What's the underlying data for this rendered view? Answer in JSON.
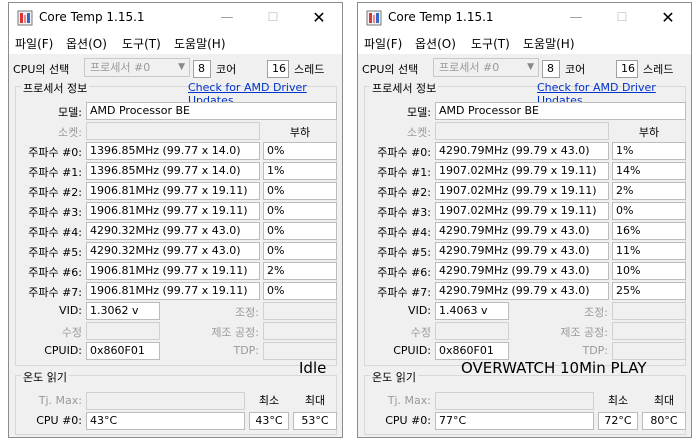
{
  "windows": [
    {
      "title": "Core Temp 1.15.1",
      "menu": [
        "파일(F)",
        "옵션(O)",
        "도구(T)",
        "도움말(H)"
      ],
      "cpu_select_label": "CPU의 선택",
      "processor_combo": "프로세서 #0",
      "cores_value": "8",
      "cores_label": "코어",
      "threads_value": "16",
      "threads_label": "스레드",
      "proc_info_label": "프로세서 정보",
      "driver_link": "Check for AMD Driver Updates",
      "model_label": "모델:",
      "model_value": "AMD Processor  BE",
      "socket_label": "소켓:",
      "load_header": "부하",
      "freqs": [
        {
          "label": "주파수 #0:",
          "value": "1396.85MHz (99.77 x 14.0)",
          "load": "0%"
        },
        {
          "label": "주파수 #1:",
          "value": "1396.85MHz (99.77 x 14.0)",
          "load": "1%"
        },
        {
          "label": "주파수 #2:",
          "value": "1906.81MHz (99.77 x 19.11)",
          "load": "0%"
        },
        {
          "label": "주파수 #3:",
          "value": "1906.81MHz (99.77 x 19.11)",
          "load": "0%"
        },
        {
          "label": "주파수 #4:",
          "value": "4290.32MHz (99.77 x 43.0)",
          "load": "0%"
        },
        {
          "label": "주파수 #5:",
          "value": "4290.32MHz (99.77 x 43.0)",
          "load": "0%"
        },
        {
          "label": "주파수 #6:",
          "value": "1906.81MHz (99.77 x 19.11)",
          "load": "2%"
        },
        {
          "label": "주파수 #7:",
          "value": "1906.81MHz (99.77 x 19.11)",
          "load": "0%"
        }
      ],
      "vid_label": "VID:",
      "vid_value": "1.3062 v",
      "revision_label": "수정",
      "lithography_label": "조정:",
      "production_label": "제조 공정:",
      "cpuid_label": "CPUID:",
      "cpuid_value": "0x860F01",
      "tdp_label": "TDP:",
      "temp_group_label": "온도 읽기",
      "tjmax_label": "Tj. Max:",
      "min_label": "최소",
      "max_label": "최대",
      "cpu0_label": "CPU #0:",
      "cpu0_temp": "43°C",
      "cpu0_min": "43°C",
      "cpu0_max": "53°C"
    },
    {
      "title": "Core Temp 1.15.1",
      "menu": [
        "파일(F)",
        "옵션(O)",
        "도구(T)",
        "도움말(H)"
      ],
      "cpu_select_label": "CPU의 선택",
      "processor_combo": "프로세서 #0",
      "cores_value": "8",
      "cores_label": "코어",
      "threads_value": "16",
      "threads_label": "스레드",
      "proc_info_label": "프로세서 정보",
      "driver_link": "Check for AMD Driver Updates",
      "model_label": "모델:",
      "model_value": "AMD Processor  BE",
      "socket_label": "소켓:",
      "load_header": "부하",
      "freqs": [
        {
          "label": "주파수 #0:",
          "value": "4290.79MHz (99.79 x 43.0)",
          "load": "1%"
        },
        {
          "label": "주파수 #1:",
          "value": "1907.02MHz (99.79 x 19.11)",
          "load": "14%"
        },
        {
          "label": "주파수 #2:",
          "value": "1907.02MHz (99.79 x 19.11)",
          "load": "2%"
        },
        {
          "label": "주파수 #3:",
          "value": "1907.02MHz (99.79 x 19.11)",
          "load": "0%"
        },
        {
          "label": "주파수 #4:",
          "value": "4290.79MHz (99.79 x 43.0)",
          "load": "16%"
        },
        {
          "label": "주파수 #5:",
          "value": "4290.79MHz (99.79 x 43.0)",
          "load": "11%"
        },
        {
          "label": "주파수 #6:",
          "value": "4290.79MHz (99.79 x 43.0)",
          "load": "10%"
        },
        {
          "label": "주파수 #7:",
          "value": "4290.79MHz (99.79 x 43.0)",
          "load": "25%"
        }
      ],
      "vid_label": "VID:",
      "vid_value": "1.4063 v",
      "revision_label": "수정",
      "lithography_label": "조정:",
      "production_label": "제조 공정:",
      "cpuid_label": "CPUID:",
      "cpuid_value": "0x860F01",
      "tdp_label": "TDP:",
      "temp_group_label": "온도 읽기",
      "tjmax_label": "Tj. Max:",
      "min_label": "최소",
      "max_label": "최대",
      "cpu0_label": "CPU #0:",
      "cpu0_temp": "77°C",
      "cpu0_min": "72°C",
      "cpu0_max": "80°C"
    }
  ],
  "captions": {
    "left": "Idle",
    "right": "OVERWATCH 10Min PLAY"
  },
  "colors": {
    "link": "#0033cc",
    "window_bg": "#f0f0f0",
    "field_bg": "#ffffff"
  }
}
